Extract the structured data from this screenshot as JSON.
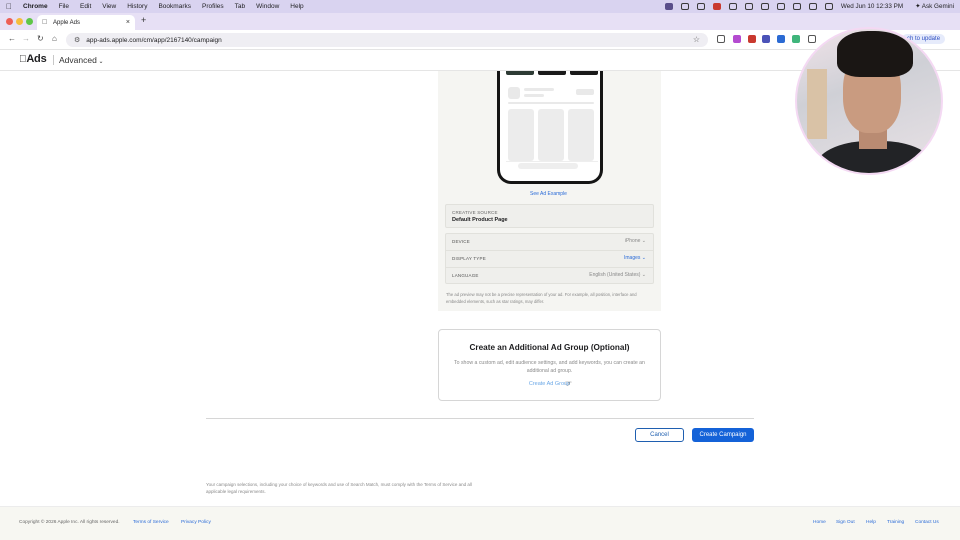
{
  "menubar": {
    "app": "Chrome",
    "items": [
      "File",
      "Edit",
      "View",
      "History",
      "Bookmarks",
      "Profiles",
      "Tab",
      "Window",
      "Help"
    ],
    "clock": "Wed Jun 10  12:33 PM",
    "ask_gemini": "Ask Gemini"
  },
  "browser": {
    "tab_title": "Apple Ads",
    "url": "app-ads.apple.com/cm/app/2167140/campaign",
    "update_label": "ch to update"
  },
  "ads_header": {
    "logo": "Ads",
    "mode": "Advanced"
  },
  "preview": {
    "see_example": "See Ad Example",
    "creative_source_label": "CREATIVE SOURCE",
    "creative_source_value": "Default Product Page",
    "device_label": "DEVICE",
    "device_value": "iPhone",
    "display_type_label": "DISPLAY TYPE",
    "display_type_value": "Images",
    "language_label": "LANGUAGE",
    "language_value": "English (United States)",
    "disclaimer": "The ad preview may not be a precise representation of your ad. For example, all position, interface and embedded elements, such as star ratings, may differ."
  },
  "additional_ad_group": {
    "title": "Create an Additional Ad Group (Optional)",
    "description": "To show a custom ad, edit audience settings, and add keywords, you can create an additional ad group.",
    "link": "Create Ad Group"
  },
  "actions": {
    "cancel": "Cancel",
    "create": "Create Campaign"
  },
  "legal_note": "Your campaign selections, including your choice of keywords and use of Search Match, must comply with the Terms of Service and all applicable legal requirements.",
  "footer": {
    "copyright": "Copyright © 2026 Apple Inc. All rights reserved.",
    "terms": "Terms of Service",
    "privacy": "Privacy Policy",
    "home": "Home",
    "sign_out": "Sign Out",
    "help": "Help",
    "training": "Training",
    "contact": "Contact Us"
  },
  "colors": {
    "primary_button": "#1462d8",
    "link": "#2a6bd8",
    "menubar": "#d9d3f0"
  }
}
